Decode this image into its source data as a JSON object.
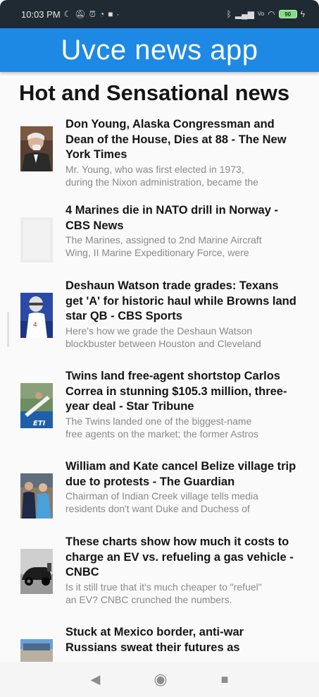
{
  "status_bar": {
    "time": "10:03 PM",
    "left_icons": [
      "moon-icon",
      "silent-icon",
      "alarm-icon",
      "sync-icon",
      "camera-icon",
      "dot-icon"
    ],
    "right_icons": [
      "bluetooth-icon",
      "signal-icon",
      "vowifi-icon",
      "wifi-icon"
    ],
    "battery": "90"
  },
  "app_bar": {
    "title": "Uvce news app",
    "color": "#1e88e5"
  },
  "section_title": "Hot and Sensational news",
  "articles": [
    {
      "title": "Don Young, Alaska Congressman and Dean of the House, Dies at 88 - The New York Times",
      "desc_line1": "Mr. Young, who was first elected in 1973,",
      "desc_line2": "during the Nixon administration, became the",
      "thumb": "portrait-photo"
    },
    {
      "title": "4 Marines die in NATO drill in Norway - CBS News",
      "desc_line1": "The Marines, assigned to 2nd Marine Aircraft",
      "desc_line2": "Wing, II Marine Expeditionary Force, were",
      "thumb": "blank-photo"
    },
    {
      "title": "Deshaun Watson trade grades: Texans get 'A' for historic haul while Browns land star QB - CBS Sports",
      "desc_line1": "Here's how we grade the Deshaun Watson",
      "desc_line2": "blockbuster between Houston and Cleveland",
      "thumb": "football-photo"
    },
    {
      "title": "Twins land free-agent shortstop Carlos Correa in stunning $105.3 million, three-year deal - Star Tribune",
      "desc_line1": "The Twins landed one of the biggest-name",
      "desc_line2": "free agents on the market; the former Astros",
      "thumb": "baseball-photo"
    },
    {
      "title": "William and Kate cancel Belize village trip due to protests - The Guardian",
      "desc_line1": "Chairman of Indian Creek village tells media",
      "desc_line2": "residents don't want Duke and Duchess of",
      "thumb": "royals-photo"
    },
    {
      "title": "These charts show how much it costs to charge an EV vs. refueling a gas vehicle - CNBC",
      "desc_line1": "Is it still true that it's much cheaper to \"refuel\"",
      "desc_line2": "an EV? CNBC crunched the numbers.",
      "thumb": "ev-car-photo"
    },
    {
      "title": "Stuck at Mexico border, anti-war Russians sweat their futures as",
      "desc_line1": "",
      "desc_line2": "",
      "thumb": "border-photo"
    }
  ],
  "nav_bar": {
    "back_icon": "back-icon",
    "home_icon": "home-icon",
    "recents_icon": "recents-icon"
  }
}
